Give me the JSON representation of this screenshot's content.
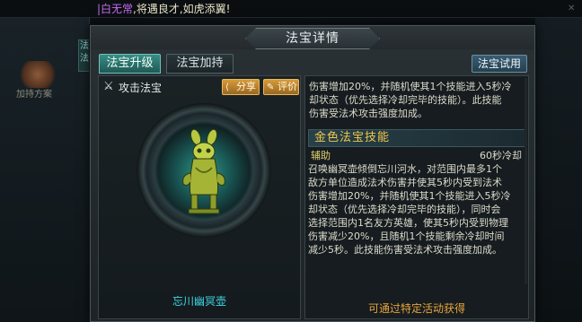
{
  "chat": {
    "prefix": "|白无常",
    "message": ",将遇良才,如虎添翼!"
  },
  "background": {
    "left_label": "加持方案",
    "left_tab": "法法"
  },
  "dialog": {
    "title": "法宝详情",
    "tabs": [
      {
        "label": "法宝升级",
        "active": true
      },
      {
        "label": "法宝加持",
        "active": false
      }
    ],
    "trial_button": "法宝试用"
  },
  "treasure": {
    "type_label": "攻击法宝",
    "type_icon": "crossed-swords-icon",
    "share_label": "分享",
    "share_icon": "share-icon",
    "review_label": "评价",
    "review_icon": "edit-icon",
    "name": "忘川幽冥壶",
    "colors": {
      "name": "#3fd7e6",
      "glow": "#50ffdc",
      "body": "#a8b832"
    }
  },
  "details": {
    "top_lines": [
      "伤害增加20%，并随机使其1个技能进入5秒冷",
      "却状态（优先选择冷却完毕的技能）。此技能",
      "伤害受法术攻击强度加成。"
    ],
    "skill_section_title": "金色法宝技能",
    "skill_type": "辅助",
    "skill_cooldown": "60秒冷却",
    "skill_lines": [
      "召唤幽冥壶倾倒忘川河水，对范围内最多1个",
      "敌方单位造成法术伤害并使其5秒内受到法术",
      "伤害增加20%，并随机使其1个技能进入5秒冷",
      "却状态（优先选择冷却完毕的技能），同时会",
      "选择范围内1名友方英雄，使其5秒内受到物理",
      "伤害减少20%，且随机1个技能剩余冷却时间",
      "减少5秒。此技能伤害受法术攻击强度加成。"
    ],
    "acquire_text": "可通过特定活动获得",
    "section_color": "#f0c84c",
    "acquire_color": "#e8a43c"
  }
}
